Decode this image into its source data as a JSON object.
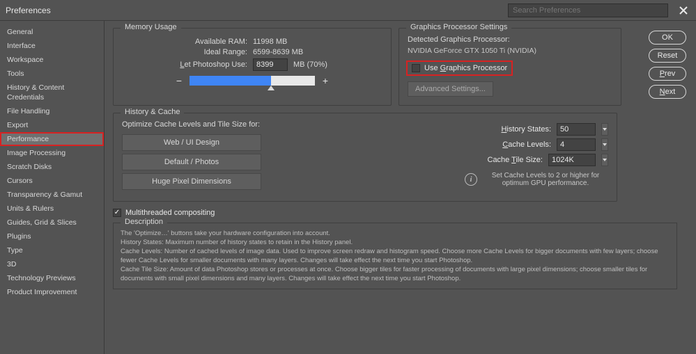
{
  "titlebar": {
    "title": "Preferences",
    "search_placeholder": "Search Preferences"
  },
  "buttons": {
    "ok": "OK",
    "reset": "Reset",
    "prev": "Prev",
    "next": "Next"
  },
  "sidebar": {
    "items": [
      {
        "label": "General"
      },
      {
        "label": "Interface"
      },
      {
        "label": "Workspace"
      },
      {
        "label": "Tools"
      },
      {
        "label": "History & Content Credentials"
      },
      {
        "label": "File Handling"
      },
      {
        "label": "Export"
      },
      {
        "label": "Performance",
        "selected": true,
        "highlight": true
      },
      {
        "label": "Image Processing"
      },
      {
        "label": "Scratch Disks"
      },
      {
        "label": "Cursors"
      },
      {
        "label": "Transparency & Gamut"
      },
      {
        "label": "Units & Rulers"
      },
      {
        "label": "Guides, Grid & Slices"
      },
      {
        "label": "Plugins"
      },
      {
        "label": "Type"
      },
      {
        "label": "3D"
      },
      {
        "label": "Technology Previews"
      },
      {
        "label": "Product Improvement"
      }
    ]
  },
  "memory": {
    "legend": "Memory Usage",
    "available_label": "Available RAM:",
    "available_value": "11998 MB",
    "ideal_label": "Ideal Range:",
    "ideal_value": "6599-8639 MB",
    "let_use_label": "Let Photoshop Use:",
    "let_use_value": "8399",
    "let_use_suffix": "MB (70%)"
  },
  "gpu": {
    "legend": "Graphics Processor Settings",
    "detected_label": "Detected Graphics Processor:",
    "gpu_name": "NVIDIA GeForce GTX 1050 Ti (NVIDIA)",
    "use_gpu_label": "Use Graphics Processor",
    "advanced_label": "Advanced Settings..."
  },
  "history_cache": {
    "legend": "History & Cache",
    "optimize_label": "Optimize Cache Levels and Tile Size for:",
    "opt1": "Web / UI Design",
    "opt2": "Default / Photos",
    "opt3": "Huge Pixel Dimensions",
    "history_states_label": "History States:",
    "history_states_value": "50",
    "cache_levels_label": "Cache Levels:",
    "cache_levels_value": "4",
    "cache_tile_label": "Cache Tile Size:",
    "cache_tile_value": "1024K",
    "info_text": "Set Cache Levels to 2 or higher for optimum GPU performance."
  },
  "multithread": {
    "label": "Multithreaded compositing",
    "checked": true
  },
  "description": {
    "legend": "Description",
    "line1": "The 'Optimize…' buttons take your hardware configuration into account.",
    "line2": "History States: Maximum number of history states to retain in the History panel.",
    "line3": "Cache Levels: Number of cached levels of image data.  Used to improve screen redraw and histogram speed.  Choose more Cache Levels for bigger documents with few layers; choose fewer Cache Levels for smaller documents with many layers. Changes will take effect the next time you start Photoshop.",
    "line4": "Cache Tile Size: Amount of data Photoshop stores or processes at once. Choose bigger tiles for faster processing of documents with large pixel dimensions; choose smaller tiles for documents with small pixel dimensions and many layers. Changes will take effect the next time you start Photoshop."
  }
}
